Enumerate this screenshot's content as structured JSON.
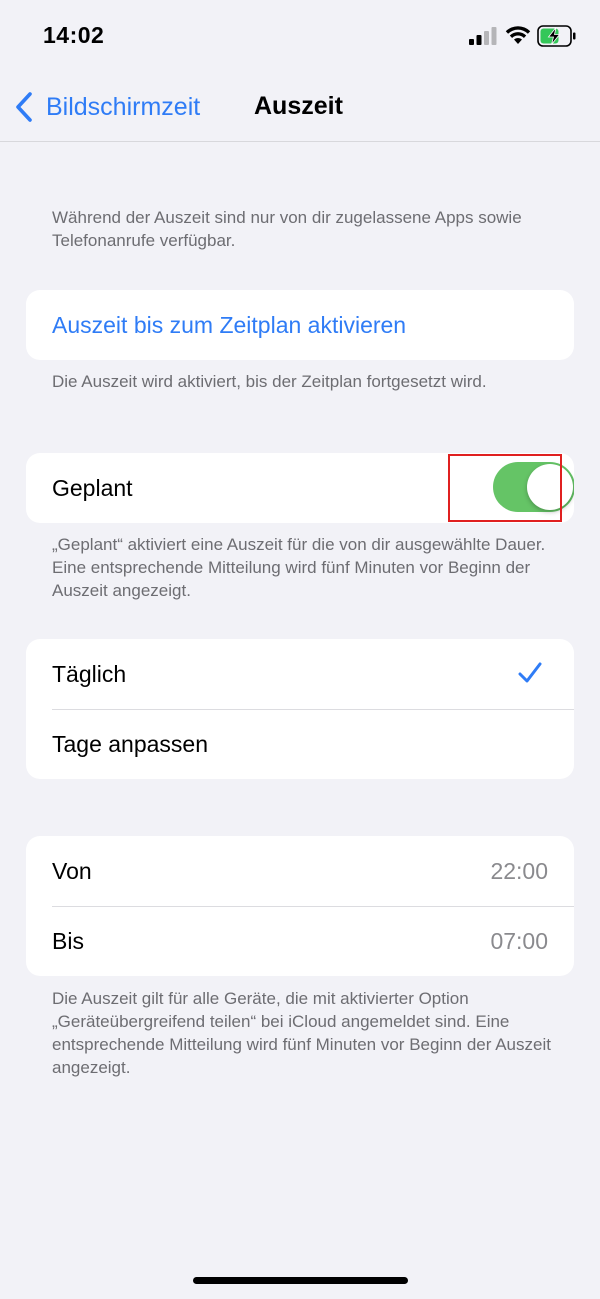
{
  "status_bar": {
    "time": "14:02",
    "signal_icon": "cellular-signal-icon",
    "wifi_icon": "wifi-icon",
    "battery_icon": "battery-charging-icon"
  },
  "nav": {
    "back_label": "Bildschirmzeit",
    "title": "Auszeit",
    "accent_color": "#2f7cf6"
  },
  "intro_text": "Während der Auszeit sind nur von dir zugelassene Apps sowie Telefonanrufe verfügbar.",
  "activate": {
    "label": "Auszeit bis zum Zeitplan aktivieren",
    "footer": "Die Auszeit wird aktiviert, bis der Zeitplan fortgesetzt wird."
  },
  "scheduled": {
    "label": "Geplant",
    "toggle_on": true,
    "toggle_color": "#65c466",
    "footer": "„Geplant“ aktiviert eine Auszeit für die von dir ausgewählte Dauer. Eine entsprechende Mitteilung wird fünf Minuten vor Beginn der Auszeit angezeigt."
  },
  "frequency": {
    "items": [
      {
        "label": "Täglich",
        "selected": true
      },
      {
        "label": "Tage anpassen",
        "selected": false
      }
    ]
  },
  "times": {
    "from_label": "Von",
    "from_value": "22:00",
    "to_label": "Bis",
    "to_value": "07:00",
    "footer": "Die Auszeit gilt für alle Geräte, die mit aktivierter Option „Geräteübergreifend teilen“ bei iCloud angemeldet sind. Eine entsprechende Mitteilung wird fünf Minuten vor Beginn der Auszeit angezeigt."
  }
}
